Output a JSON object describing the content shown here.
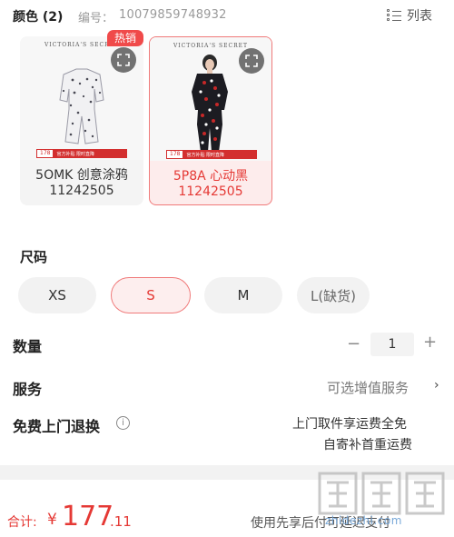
{
  "header": {
    "color_title": "颜色 (2)",
    "sku_label": "编号：",
    "sku_value": "10079859748932",
    "list_label": "列表"
  },
  "colors": [
    {
      "name": "5OMK 创意涂鸦",
      "code": "11242505",
      "brand": "VICTORIA'S SECRET",
      "promo_price": "178",
      "promo_text": "官方补贴 限时直降",
      "selected": false
    },
    {
      "name": "5P8A 心动黑",
      "code": "11242505",
      "brand": "VICTORIA'S SECRET",
      "promo_price": "178",
      "promo_text": "官方补贴 限时直降",
      "selected": true
    }
  ],
  "hot_tag": "热销",
  "size": {
    "title": "尺码",
    "options": [
      {
        "label": "XS",
        "state": "normal"
      },
      {
        "label": "S",
        "state": "selected"
      },
      {
        "label": "M",
        "state": "normal"
      },
      {
        "label": "L(缺货)",
        "state": "disabled"
      }
    ]
  },
  "quantity": {
    "label": "数量",
    "minus": "−",
    "value": "1",
    "plus": "+"
  },
  "service": {
    "label": "服务",
    "value": "可选增值服务",
    "arrow": "›"
  },
  "free_return": {
    "label": "免费上门退换",
    "info_icon": "i",
    "line1": "上门取件享运费全免",
    "line2": "自寄补首重运费"
  },
  "footer": {
    "total_label": "合计:",
    "currency": "¥",
    "price_int": "177",
    "price_dec": ".11",
    "pay_later": "使用先享后付可延迟支付",
    "watermark_text": "zhidezhi.com"
  },
  "colors_theme": {
    "accent": "#e53935",
    "selected_bg": "#fdeeee",
    "neutral_bg": "#f2f2f2"
  }
}
